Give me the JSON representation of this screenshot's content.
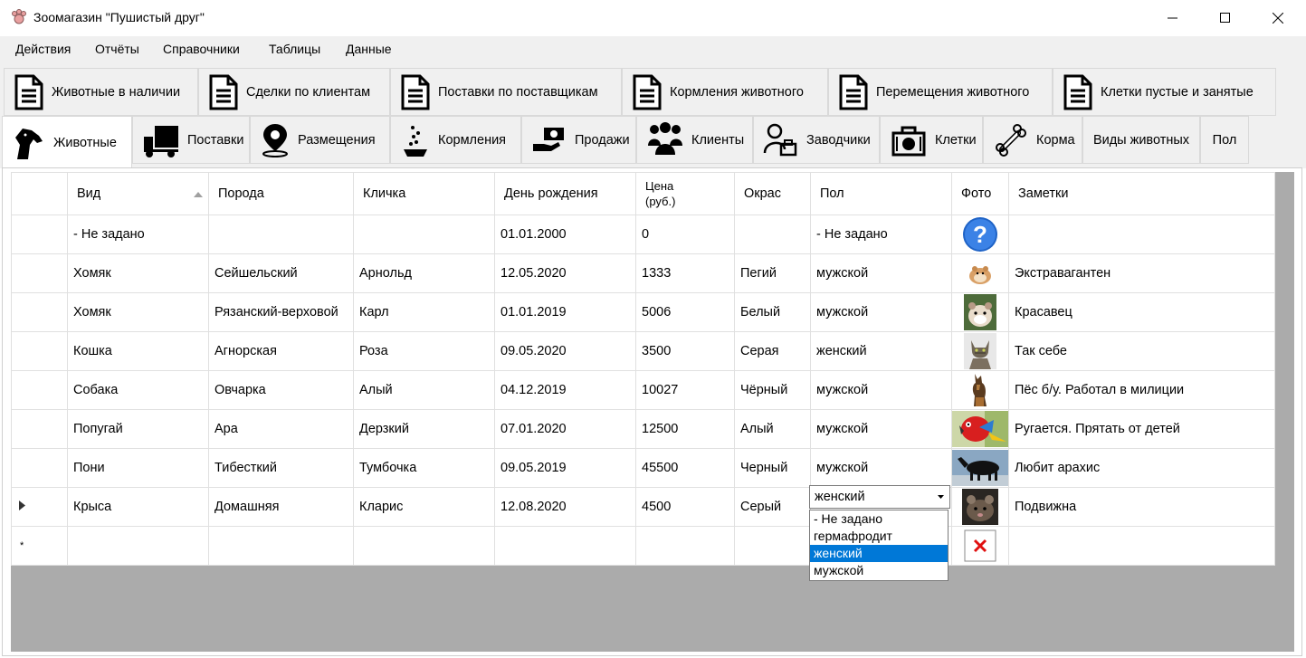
{
  "window": {
    "title": "Зоомагазин \"Пушистый друг\""
  },
  "menu": [
    "Действия",
    "Отчёты",
    "Справочники",
    "Таблицы",
    "Данные"
  ],
  "report_tabs": [
    {
      "label": "Животные в наличии",
      "icon": "document-icon"
    },
    {
      "label": "Сделки по клиентам",
      "icon": "document-icon"
    },
    {
      "label": "Поставки по поставщикам",
      "icon": "document-icon"
    },
    {
      "label": "Кормления животного",
      "icon": "document-icon"
    },
    {
      "label": "Перемещения животного",
      "icon": "document-icon"
    },
    {
      "label": "Клетки пустые и занятые",
      "icon": "document-icon"
    }
  ],
  "data_tabs": [
    {
      "label": "Животные",
      "icon": "dog-icon",
      "active": true
    },
    {
      "label": "Поставки",
      "icon": "truck-icon"
    },
    {
      "label": "Размещения",
      "icon": "location-pin-icon"
    },
    {
      "label": "Кормления",
      "icon": "feeding-bowl-icon"
    },
    {
      "label": "Продажи",
      "icon": "money-hand-icon"
    },
    {
      "label": "Клиенты",
      "icon": "people-icon"
    },
    {
      "label": "Заводчики",
      "icon": "breeder-icon"
    },
    {
      "label": "Клетки",
      "icon": "pet-carrier-icon"
    },
    {
      "label": "Корма",
      "icon": "bone-icon"
    },
    {
      "label": "Виды животных",
      "icon": ""
    },
    {
      "label": "Пол",
      "icon": ""
    }
  ],
  "grid": {
    "columns": {
      "species": "Вид",
      "breed": "Порода",
      "name": "Кличка",
      "birthday": "День рождения",
      "price_line1": "Цена",
      "price_line2": "(руб.)",
      "color": "Окрас",
      "sex": "Пол",
      "photo": "Фото",
      "notes": "Заметки"
    },
    "sorted_column": "Вид",
    "rows": [
      {
        "species": "- Не задано",
        "breed": "",
        "name": "",
        "birthday": "01.01.2000",
        "price": "0",
        "color": "",
        "sex": "- Не задано",
        "photo": "question-mark-icon",
        "notes": ""
      },
      {
        "species": "Хомяк",
        "breed": "Сейшельский",
        "name": "Арнольд",
        "birthday": "12.05.2020",
        "price": "1333",
        "color": "Пегий",
        "sex": "мужской",
        "photo": "hamster-photo",
        "notes": "Экстравагантен"
      },
      {
        "species": "Хомяк",
        "breed": "Рязанский-верховой",
        "name": "Карл",
        "birthday": "01.01.2019",
        "price": "5006",
        "color": "Белый",
        "sex": "мужской",
        "photo": "hamster-photo",
        "notes": "Красавец"
      },
      {
        "species": "Кошка",
        "breed": "Агнорская",
        "name": "Роза",
        "birthday": "09.05.2020",
        "price": "3500",
        "color": "Серая",
        "sex": "женский",
        "photo": "cat-photo",
        "notes": "Так себе"
      },
      {
        "species": "Собака",
        "breed": "Овчарка",
        "name": "Алый",
        "birthday": "04.12.2019",
        "price": "10027",
        "color": "Чёрный",
        "sex": "мужской",
        "photo": "dog-photo",
        "notes": "Пёс б/у. Работал в милиции"
      },
      {
        "species": "Попугай",
        "breed": "Ара",
        "name": "Дерзкий",
        "birthday": "07.01.2020",
        "price": "12500",
        "color": "Алый",
        "sex": "мужской",
        "photo": "parrot-photo",
        "notes": "Ругается. Прятать от детей"
      },
      {
        "species": "Пони",
        "breed": "Тибесткий",
        "name": "Тумбочка",
        "birthday": "09.05.2019",
        "price": "45500",
        "color": "Черный",
        "sex": "мужской",
        "photo": "pony-photo",
        "notes": "Любит арахис"
      },
      {
        "species": "Крыса",
        "breed": "Домашняя",
        "name": "Кларис",
        "birthday": "12.08.2020",
        "price": "4500",
        "color": "Серый",
        "sex": "женский",
        "photo": "rat-photo",
        "notes": "Подвижна"
      }
    ],
    "current_row_index": 7,
    "new_row_marker": "*",
    "new_row_photo": "missing-image-icon"
  },
  "sex_dropdown": {
    "value": "женский",
    "options": [
      "- Не задано",
      "гермафродит",
      "женский",
      "мужской"
    ],
    "selected_index": 2
  },
  "colors": {
    "selection": "#0078d7",
    "grid_background": "#ababab",
    "tab_strip": "#f0f0f0"
  }
}
